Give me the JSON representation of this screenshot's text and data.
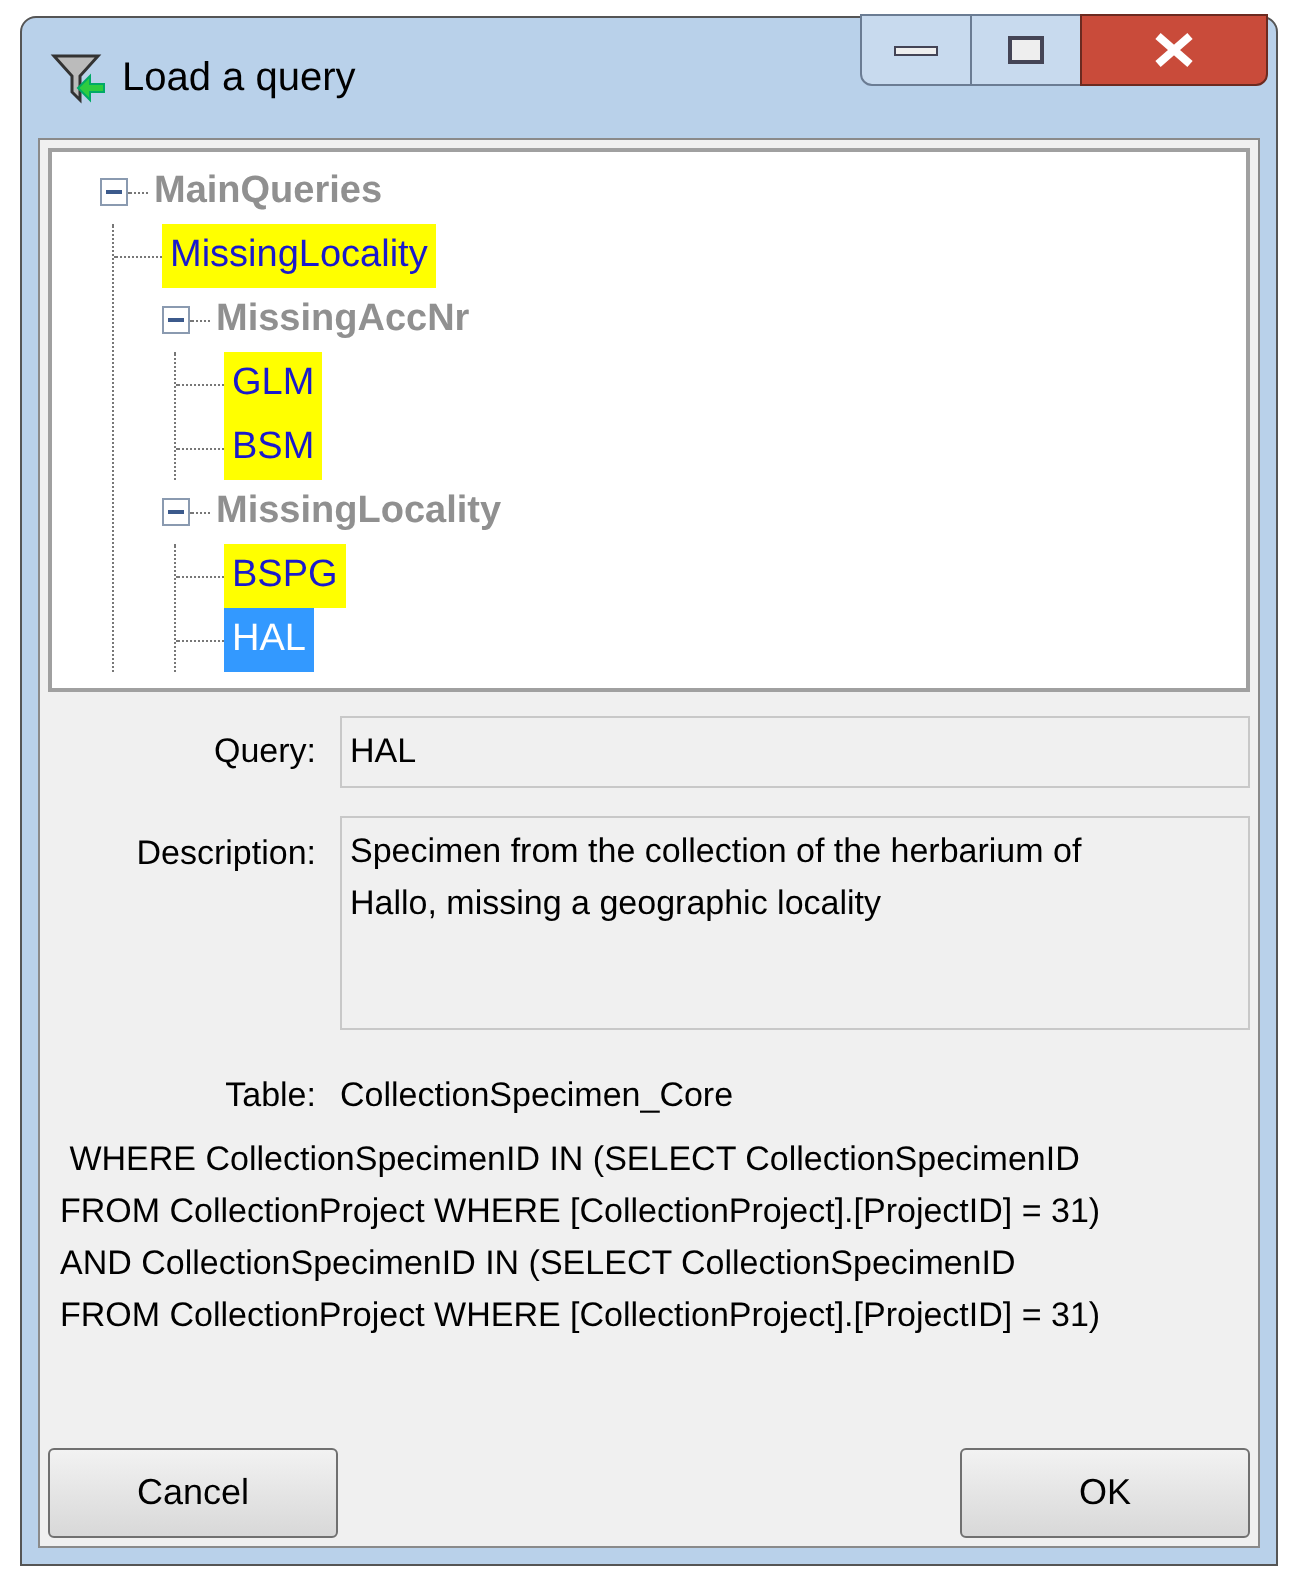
{
  "window": {
    "title": "Load a query"
  },
  "tree": [
    {
      "label": "MainQueries",
      "kind": "group",
      "expanded": true,
      "children": [
        {
          "label": "MissingLocality",
          "kind": "query",
          "selected": false
        },
        {
          "label": "MissingAccNr",
          "kind": "group",
          "expanded": true,
          "children": [
            {
              "label": "GLM",
              "kind": "query",
              "selected": false
            },
            {
              "label": "BSM",
              "kind": "query",
              "selected": false
            }
          ]
        },
        {
          "label": "MissingLocality",
          "kind": "group",
          "expanded": true,
          "children": [
            {
              "label": "BSPG",
              "kind": "query",
              "selected": false
            },
            {
              "label": "HAL",
              "kind": "query",
              "selected": true
            }
          ]
        }
      ]
    }
  ],
  "query": {
    "label": "Query:",
    "value": "HAL"
  },
  "description": {
    "label": "Description:",
    "value": "Specimen from the collection of the herbarium of Hallo, missing a geographic locality"
  },
  "table": {
    "label": "Table:",
    "value": "CollectionSpecimen_Core"
  },
  "sql": " WHERE CollectionSpecimenID IN (SELECT CollectionSpecimenID FROM CollectionProject WHERE [CollectionProject].[ProjectID] = 31) AND CollectionSpecimenID IN (SELECT CollectionSpecimenID FROM CollectionProject WHERE [CollectionProject].[ProjectID] = 31)",
  "buttons": [
    {
      "label": "Cancel"
    },
    {
      "label": "OK"
    }
  ]
}
